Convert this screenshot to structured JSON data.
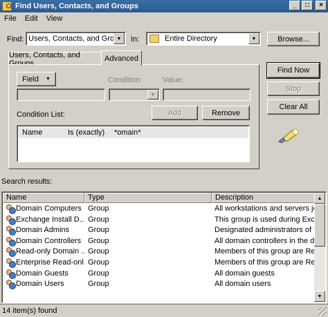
{
  "window": {
    "title": "Find Users, Contacts, and Groups"
  },
  "menu": [
    "File",
    "Edit",
    "View"
  ],
  "find": {
    "label": "Find:",
    "value": "Users, Contacts, and Groups"
  },
  "in": {
    "label": "In:",
    "value": "Entire Directory"
  },
  "buttons": {
    "browse": "Browse...",
    "find_now": "Find Now",
    "stop": "Stop",
    "clear_all": "Clear All",
    "field": "Field",
    "add": "Add",
    "remove": "Remove"
  },
  "tabs": [
    "Users, Contacts, and Groups",
    "Advanced"
  ],
  "advanced": {
    "condition_label": "Condition:",
    "value_label": "Value:",
    "condition_list_label": "Condition List:",
    "condition_row": {
      "name": "Name",
      "condition": "Is (exactly)",
      "value": "*omain*"
    }
  },
  "results": {
    "label": "Search results:",
    "columns": [
      "Name",
      "Type",
      "Description"
    ],
    "rows": [
      [
        "Domain Computers",
        "Group",
        "All workstations and servers joine"
      ],
      [
        "Exchange Install D...",
        "Group",
        "This group is used during Exchang"
      ],
      [
        "Domain Admins",
        "Group",
        "Designated administrators of the"
      ],
      [
        "Domain Controllers",
        "Group",
        "All domain controllers in the doma"
      ],
      [
        "Read-only Domain ...",
        "Group",
        "Members of this group are Read-"
      ],
      [
        "Enterprise Read-onl...",
        "Group",
        "Members of this group are Read-"
      ],
      [
        "Domain Guests",
        "Group",
        "All domain guests"
      ],
      [
        "Domain Users",
        "Group",
        "All domain users"
      ]
    ]
  },
  "status": "14 item(s) found"
}
